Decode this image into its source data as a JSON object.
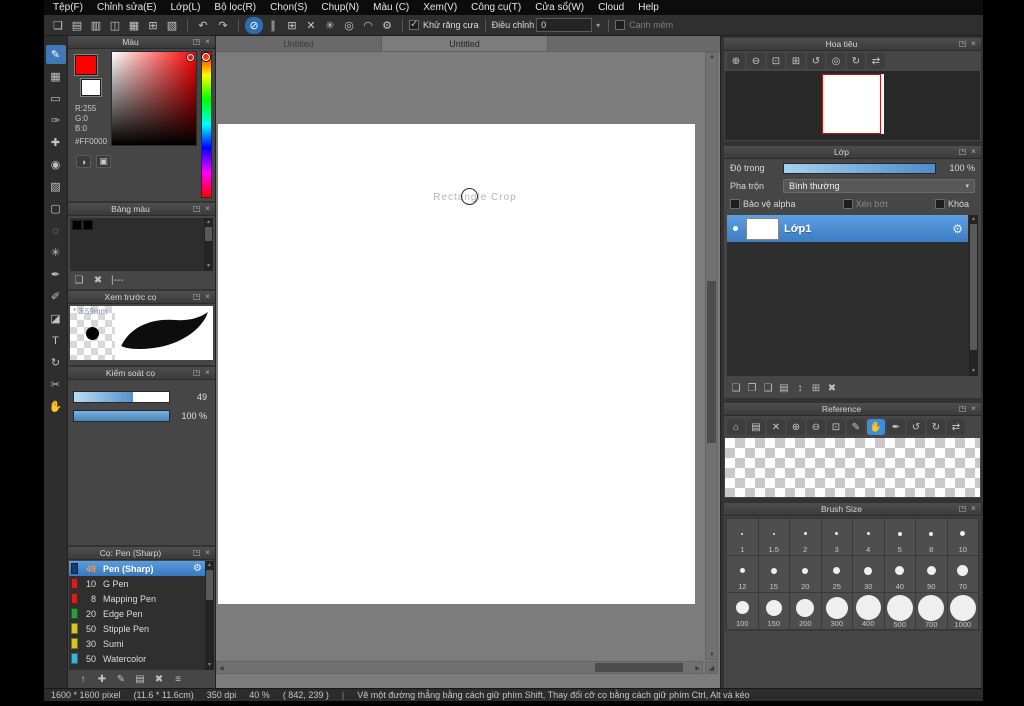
{
  "ui": {
    "detach_icon": "◳",
    "close_icon": "×",
    "dropdown_arrow": "▾",
    "undo_icon": "↶",
    "redo_icon": "↷",
    "scroll_up": "▲",
    "scroll_down": "▼",
    "scroll_left": "◀",
    "scroll_right": "▶",
    "gear_icon": "⚙",
    "separator": "|",
    "corner_icon": "◢",
    "accent_color": "#3a8edb"
  },
  "menubar": {
    "items": [
      "Tệp(F)",
      "Chỉnh sửa(E)",
      "Lớp(L)",
      "Bộ lọc(R)",
      "Chọn(S)",
      "Chụp(N)",
      "Màu (C)",
      "Xem(V)",
      "Công cụ(T)",
      "Cửa sổ(W)",
      "Cloud",
      "Help"
    ]
  },
  "toolbar": {
    "file_icons": [
      {
        "name": "new-canvas-icon",
        "glyph": "❏"
      },
      {
        "name": "open-file-icon",
        "glyph": "▤"
      },
      {
        "name": "save-file-icon",
        "glyph": "▥"
      },
      {
        "name": "comment-icon",
        "glyph": "◫"
      },
      {
        "name": "panel-layout-icon",
        "glyph": "▦"
      },
      {
        "name": "grid-view-icon",
        "glyph": "⊞"
      },
      {
        "name": "material-icon",
        "glyph": "▧"
      }
    ],
    "snap_icons": [
      {
        "name": "snap-off-icon",
        "glyph": "⊘",
        "active": true
      },
      {
        "name": "parallel-snap-icon",
        "glyph": "∥"
      },
      {
        "name": "crisscross-snap-icon",
        "glyph": "⊞"
      },
      {
        "name": "vanishing-point-snap-icon",
        "glyph": "✕"
      },
      {
        "name": "radial-snap-icon",
        "glyph": "✳"
      },
      {
        "name": "circle-snap-icon",
        "glyph": "◎"
      },
      {
        "name": "curve-snap-icon",
        "glyph": "◠"
      },
      {
        "name": "snap-settings-icon",
        "glyph": "⚙"
      }
    ],
    "antialias_label": "Khử răng cưa",
    "antialias_checked": true,
    "correction_label": "Điều chỉnh",
    "correction_value": "0",
    "softedge_label": "Cạnh mềm",
    "softedge_checked": false
  },
  "tools": [
    {
      "name": "brush-tool-icon",
      "glyph": "✎",
      "active": true
    },
    {
      "name": "selection-grid-tool-icon",
      "glyph": "▦"
    },
    {
      "name": "rectangle-tool-icon",
      "glyph": "▭"
    },
    {
      "name": "paintbrush-tool-icon",
      "glyph": "✑"
    },
    {
      "name": "move-tool-icon",
      "glyph": "✚"
    },
    {
      "name": "bucket-tool-icon",
      "glyph": "◉"
    },
    {
      "name": "gradient-tool-icon",
      "glyph": "▨"
    },
    {
      "name": "select-tool-icon",
      "glyph": "▢"
    },
    {
      "name": "lasso-tool-icon",
      "glyph": "◌"
    },
    {
      "name": "magic-wand-tool-icon",
      "glyph": "✳"
    },
    {
      "name": "eyedropper-tool-icon",
      "glyph": "✒"
    },
    {
      "name": "pen-tool-icon",
      "glyph": "✐"
    },
    {
      "name": "eraser-tool-icon",
      "glyph": "◪"
    },
    {
      "name": "text-tool-icon",
      "glyph": "T"
    },
    {
      "name": "rotate-tool-icon",
      "glyph": "↻"
    },
    {
      "name": "divide-tool-icon",
      "glyph": "✂"
    },
    {
      "name": "hand-tool-icon",
      "glyph": "✋"
    }
  ],
  "tabs": [
    {
      "label": "Untitled",
      "active": false
    },
    {
      "label": "Untitled",
      "active": true
    }
  ],
  "canvas": {
    "hint": "Rectangle Crop"
  },
  "panels": {
    "color": {
      "title": "Màu",
      "primary": "#FF0000",
      "secondary": "#FFFFFF",
      "r_label": "R:255",
      "g_label": "G:0",
      "b_label": "B:0",
      "hex": "#FF0000",
      "mode_icons": [
        {
          "name": "color-wheel-icon",
          "glyph": "◑"
        },
        {
          "name": "color-compare-icon",
          "glyph": "▣"
        }
      ]
    },
    "palette": {
      "title": "Bảng màu",
      "swatches": [
        "#000000",
        "#000000"
      ],
      "footer_icons": [
        {
          "name": "add-swatch-icon",
          "glyph": "❏"
        },
        {
          "name": "delete-swatch-icon",
          "glyph": "✖"
        },
        {
          "name": "palette-menu-icon",
          "glyph": "|---"
        }
      ]
    },
    "brush_preview": {
      "title": "Xem trước cọ",
      "size_label": "* 3.59mm"
    },
    "brush_control": {
      "title": "Kiểm soát cọ",
      "size_value": "49",
      "size_fill": "62%",
      "opacity_value": "100 %",
      "opacity_fill": "100%"
    },
    "brush_list": {
      "title": "Cọ: Pen (Sharp)",
      "brushes": [
        {
          "size": "49",
          "name": "Pen (Sharp)",
          "tag": "#1c3a66",
          "selected": true
        },
        {
          "size": "10",
          "name": "G Pen",
          "tag": "#cc2222"
        },
        {
          "size": "8",
          "name": "Mapping Pen",
          "tag": "#cc2222"
        },
        {
          "size": "20",
          "name": "Edge Pen",
          "tag": "#2a9a3a"
        },
        {
          "size": "50",
          "name": "Stipple Pen",
          "tag": "#d4c422"
        },
        {
          "size": "30",
          "name": "Sumi",
          "tag": "#d4c422"
        },
        {
          "size": "50",
          "name": "Watercolor",
          "tag": "#3ab4d4"
        }
      ],
      "footer_icons": [
        {
          "name": "prev-brush-icon",
          "glyph": "↑"
        },
        {
          "name": "add-brush-icon",
          "glyph": "✚"
        },
        {
          "name": "edit-brush-icon",
          "glyph": "✎"
        },
        {
          "name": "brush-folder-icon",
          "glyph": "▤"
        },
        {
          "name": "delete-brush-icon",
          "glyph": "✖"
        },
        {
          "name": "brush-menu-icon",
          "glyph": "≡"
        }
      ]
    },
    "navigator": {
      "title": "Hoa tiêu",
      "toolbar_icons": [
        {
          "name": "nav-zoom-in-icon",
          "glyph": "⊕"
        },
        {
          "name": "nav-zoom-out-icon",
          "glyph": "⊖"
        },
        {
          "name": "nav-zoom-fit-icon",
          "glyph": "⊡"
        },
        {
          "name": "nav-zoom-actual-icon",
          "glyph": "⊞"
        },
        {
          "name": "nav-rotate-ccw-icon",
          "glyph": "↺"
        },
        {
          "name": "nav-rotate-reset-icon",
          "glyph": "◎"
        },
        {
          "name": "nav-rotate-cw-icon",
          "glyph": "↻"
        },
        {
          "name": "nav-flip-icon",
          "glyph": "⇄"
        }
      ]
    },
    "layer": {
      "title": "Lớp",
      "opacity_label": "Độ trong",
      "opacity_value": "100 %",
      "opacity_fill": "100%",
      "blend_label": "Pha trộn",
      "blend_value": "Bình thường",
      "alpha_label": "Bảo vệ alpha",
      "clip_label": "Xén bớt",
      "lock_label": "Khóa",
      "layers": [
        {
          "name": "Lớp1",
          "visible": true,
          "selected": true
        }
      ],
      "footer_icons": [
        {
          "name": "add-layer-icon",
          "glyph": "❏"
        },
        {
          "name": "duplicate-layer-icon",
          "glyph": "❐"
        },
        {
          "name": "transfer-layer-icon",
          "glyph": "❑"
        },
        {
          "name": "add-layer-folder-icon",
          "glyph": "▤"
        },
        {
          "name": "reorder-layer-icon",
          "glyph": "↕"
        },
        {
          "name": "merge-layer-icon",
          "glyph": "⊞"
        },
        {
          "name": "delete-layer-icon",
          "glyph": "✖"
        }
      ]
    },
    "reference": {
      "title": "Reference",
      "toolbar_icons": [
        {
          "name": "ref-home-icon",
          "glyph": "⌂"
        },
        {
          "name": "ref-open-icon",
          "glyph": "▤"
        },
        {
          "name": "ref-clear-icon",
          "glyph": "✕"
        },
        {
          "name": "ref-zoom-in-icon",
          "glyph": "⊕"
        },
        {
          "name": "ref-zoom-out-icon",
          "glyph": "⊖"
        },
        {
          "name": "ref-zoom-fit-icon",
          "glyph": "⊡"
        },
        {
          "name": "ref-pencil-icon",
          "glyph": "✎"
        },
        {
          "name": "ref-hand-icon",
          "glyph": "✋",
          "active": true
        },
        {
          "name": "ref-eyedropper-icon",
          "glyph": "✒"
        },
        {
          "name": "ref-rotate-ccw-icon",
          "glyph": "↺"
        },
        {
          "name": "ref-rotate-cw-icon",
          "glyph": "↻"
        },
        {
          "name": "ref-flip-icon",
          "glyph": "⇄"
        }
      ]
    },
    "brush_size": {
      "title": "Brush Size",
      "sizes": [
        "1",
        "1.5",
        "2",
        "3",
        "4",
        "5",
        "8",
        "10",
        "12",
        "15",
        "20",
        "25",
        "30",
        "40",
        "50",
        "70",
        "100",
        "150",
        "200",
        "300",
        "400",
        "500",
        "700",
        "1000"
      ]
    }
  },
  "statusbar": {
    "size": "1600 * 1600 pixel",
    "dims": "(11.6 * 11.6cm)",
    "dpi": "350 dpi",
    "zoom": "40 %",
    "coords": "( 842, 239 )",
    "hint": "Vẽ một đường thẳng bằng cách giữ phím Shift, Thay đổi cỡ cọ bằng cách giữ phím Ctrl, Alt và kéo"
  }
}
